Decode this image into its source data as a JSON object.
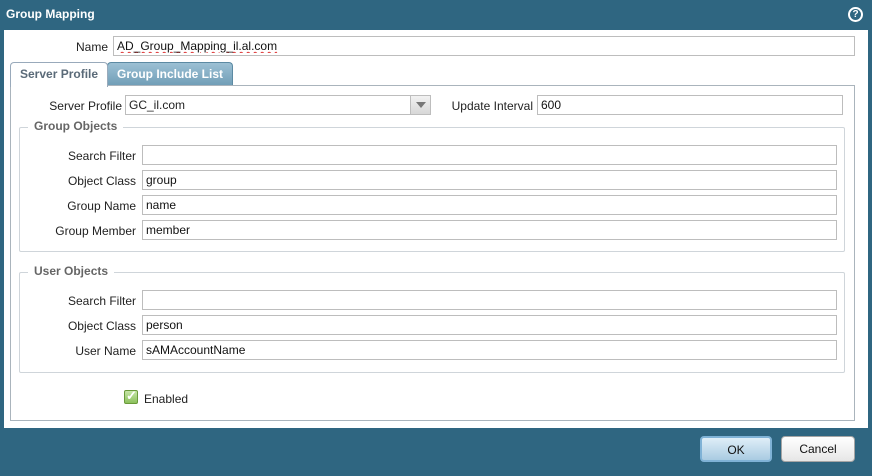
{
  "dialog": {
    "title": "Group Mapping",
    "help_icon": "question-icon",
    "name_label": "Name",
    "name_value": "AD_Group_Mapping_il.al.com"
  },
  "tabs": [
    {
      "label": "Server Profile",
      "active": true
    },
    {
      "label": "Group Include List",
      "active": false
    }
  ],
  "server": {
    "profile_label": "Server Profile",
    "profile_value": "GC_il.com",
    "interval_label": "Update Interval",
    "interval_value": "600"
  },
  "group_objects": {
    "title": "Group Objects",
    "search_filter_label": "Search Filter",
    "search_filter_value": "",
    "object_class_label": "Object Class",
    "object_class_value": "group",
    "group_name_label": "Group Name",
    "group_name_value": "name",
    "group_member_label": "Group Member",
    "group_member_value": "member"
  },
  "user_objects": {
    "title": "User Objects",
    "search_filter_label": "Search Filter",
    "search_filter_value": "",
    "object_class_label": "Object Class",
    "object_class_value": "person",
    "user_name_label": "User Name",
    "user_name_value": "sAMAccountName"
  },
  "enabled": {
    "label": "Enabled",
    "checked": true
  },
  "buttons": {
    "ok": "OK",
    "cancel": "Cancel"
  },
  "colors": {
    "frame": "#2f6681",
    "tab_active_text": "#5a6a78",
    "check": "#8cc05c"
  }
}
